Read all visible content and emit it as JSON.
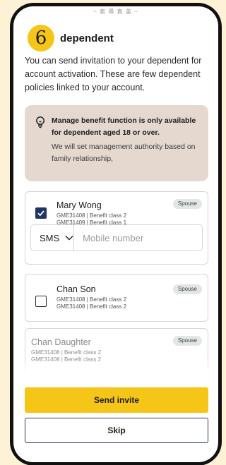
{
  "header_faded": "~ 索 尋 直 盖 ~",
  "step_number": "6",
  "title": "dependent",
  "intro": "You can send invitation to your dependent for account activation. These are few dependent policies linked to your account.",
  "notice": {
    "bold": "Manage benefit function is only available for dependent aged 18 or over.",
    "text": "We will set management authority based on family relationship,"
  },
  "dependents": [
    {
      "name": "Mary Wong",
      "relation": "Spouse",
      "policy1": "GME31408 | Benefit class 2",
      "policy2": "GME31409 | Benefit class 1",
      "checked": true
    },
    {
      "name": "Chan Son",
      "relation": "Spouse",
      "policy1": "GME31408 | Benefit class 2",
      "policy2": "GME31408 | Benefit class 2",
      "checked": false
    },
    {
      "name": "Chan Daughter",
      "relation": "Spouse",
      "policy1": "GME31408 | Benefit class 2",
      "policy2": "GME31408 | Benefit class 2",
      "checked": false
    }
  ],
  "contact": {
    "method": "SMS",
    "placeholder": "Mobile number"
  },
  "buttons": {
    "send": "Send invite",
    "skip": "Skip"
  },
  "colors": {
    "accent": "#f5c518",
    "navy": "#1f3563",
    "notice_bg": "#e4d8cf"
  }
}
